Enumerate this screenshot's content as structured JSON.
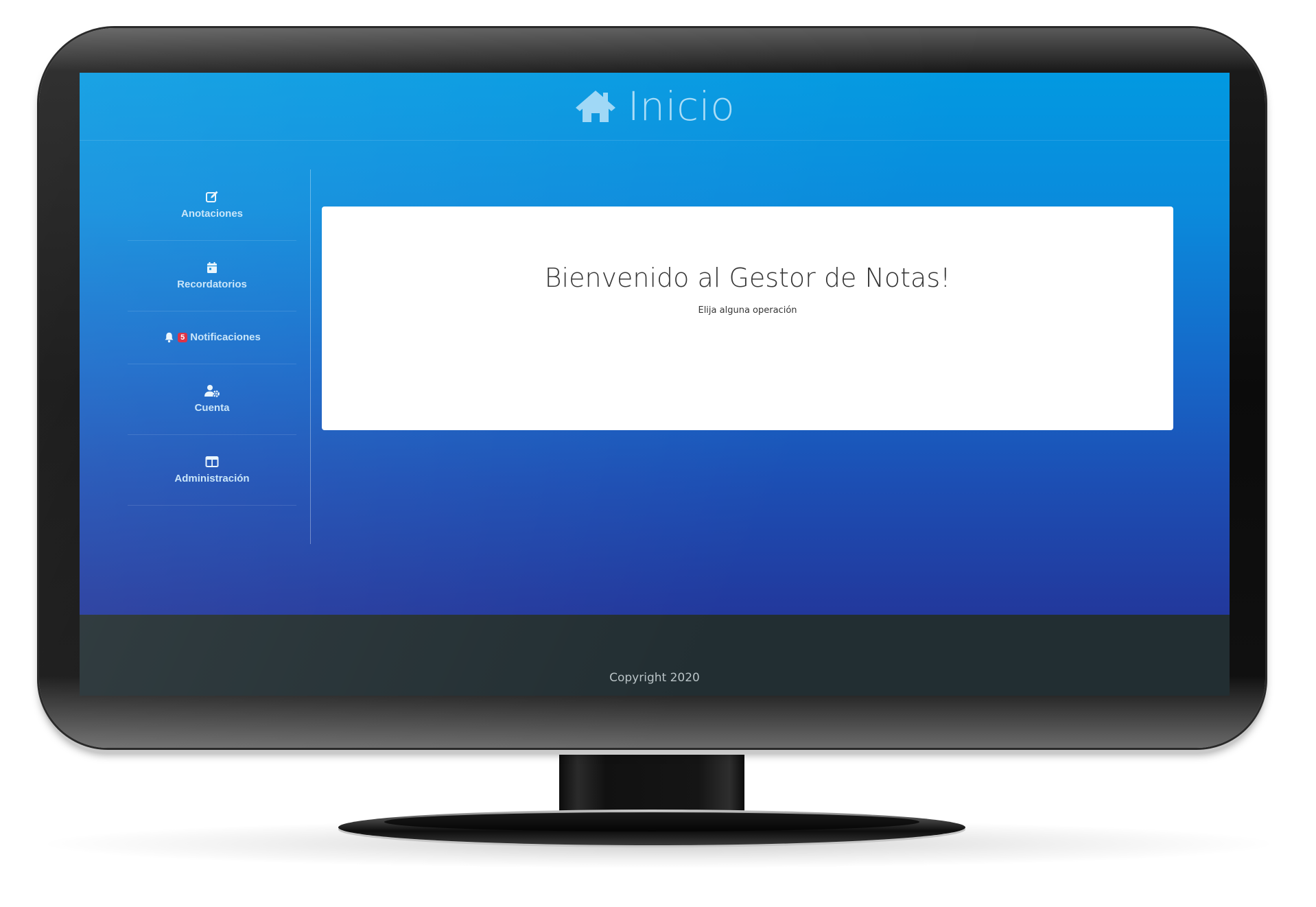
{
  "header": {
    "title": "Inicio",
    "icon": "home-icon"
  },
  "sidebar": {
    "items": [
      {
        "label": "Anotaciones",
        "icon": "edit-icon"
      },
      {
        "label": "Recordatorios",
        "icon": "calendar-icon"
      },
      {
        "label": "Notificaciones",
        "icon": "bell-icon",
        "badge": "5"
      },
      {
        "label": "Cuenta",
        "icon": "user-cog-icon"
      },
      {
        "label": "Administración",
        "icon": "table-icon"
      }
    ]
  },
  "main": {
    "welcome": "Bienvenido al Gestor de Notas!",
    "subtitle": "Elija alguna operación"
  },
  "footer": {
    "copyright": "Copyright 2020"
  },
  "colors": {
    "gradient_top": "#0299e1",
    "gradient_bottom": "#22389c",
    "footer": "#222e32",
    "badge": "#d9253a"
  }
}
